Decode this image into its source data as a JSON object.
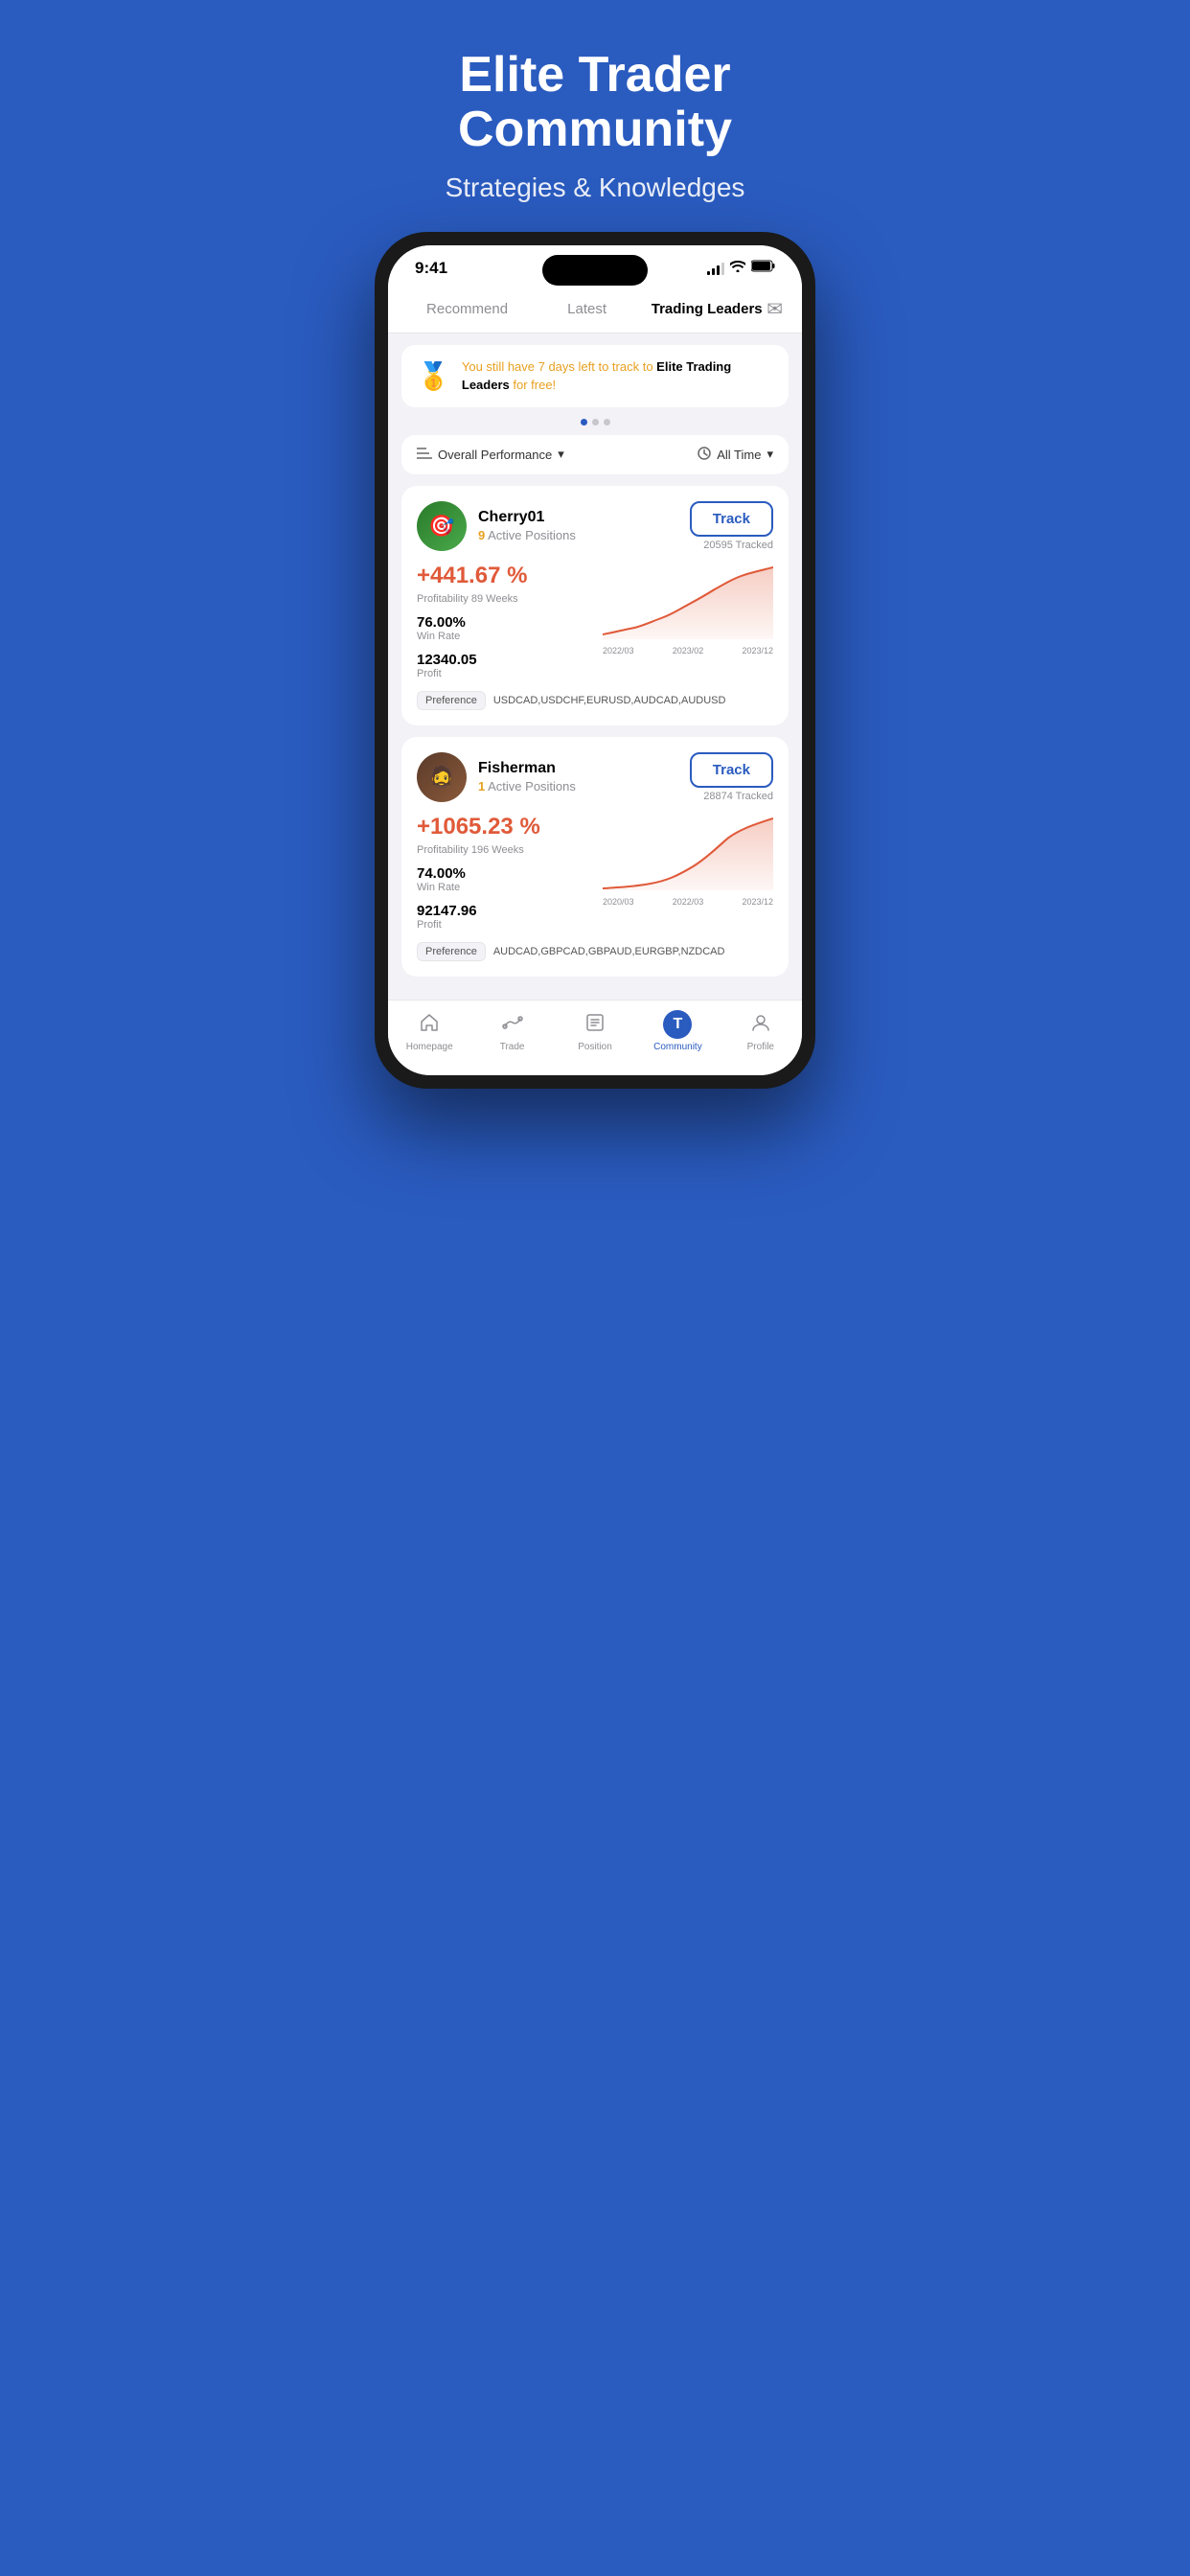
{
  "hero": {
    "title": "Elite Trader\nCommunity",
    "subtitle": "Strategies & Knowledges"
  },
  "status_bar": {
    "time": "9:41",
    "signal": "signal",
    "wifi": "wifi",
    "battery": "battery"
  },
  "nav_tabs": {
    "recommend": "Recommend",
    "latest": "Latest",
    "trading_leaders": "Trading Leaders"
  },
  "banner": {
    "text_highlight": "You still have 7 days left to track to",
    "text_bold": "Elite Trading Leaders",
    "text_suffix": "for free!"
  },
  "filter": {
    "performance_label": "Overall Performance",
    "time_label": "All Time"
  },
  "traders": [
    {
      "name": "Cherry01",
      "active_positions": "9",
      "active_positions_label": "Active Positions",
      "track_label": "Track",
      "tracked_count": "20595 Tracked",
      "return_pct": "+441.67 %",
      "profitability_label": "Profitability",
      "weeks": "89 Weeks",
      "win_rate_value": "76.00%",
      "win_rate_label": "Win Rate",
      "profit_value": "12340.05",
      "profit_label": "Profit",
      "chart_dates": [
        "2022/03",
        "2023/02",
        "2023/12"
      ],
      "preference_label": "Preference",
      "preference_values": "USDCAD,USDCHF,EURUSD,AUDCAD,AUDUSD"
    },
    {
      "name": "Fisherman",
      "active_positions": "1",
      "active_positions_label": "Active Positions",
      "track_label": "Track",
      "tracked_count": "28874 Tracked",
      "return_pct": "+1065.23 %",
      "profitability_label": "Profitability",
      "weeks": "196 Weeks",
      "win_rate_value": "74.00%",
      "win_rate_label": "Win Rate",
      "profit_value": "92147.96",
      "profit_label": "Profit",
      "chart_dates": [
        "2020/03",
        "2022/03",
        "2023/12"
      ],
      "preference_label": "Preference",
      "preference_values": "AUDCAD,GBPCAD,GBPAUD,EURGBP,NZDCAD"
    }
  ],
  "bottom_nav": [
    {
      "label": "Homepage",
      "icon": "🏠",
      "active": false
    },
    {
      "label": "Trade",
      "icon": "〜",
      "active": false
    },
    {
      "label": "Position",
      "icon": "📋",
      "active": false
    },
    {
      "label": "Community",
      "icon": "T",
      "active": true
    },
    {
      "label": "Profile",
      "icon": "👤",
      "active": false
    }
  ]
}
